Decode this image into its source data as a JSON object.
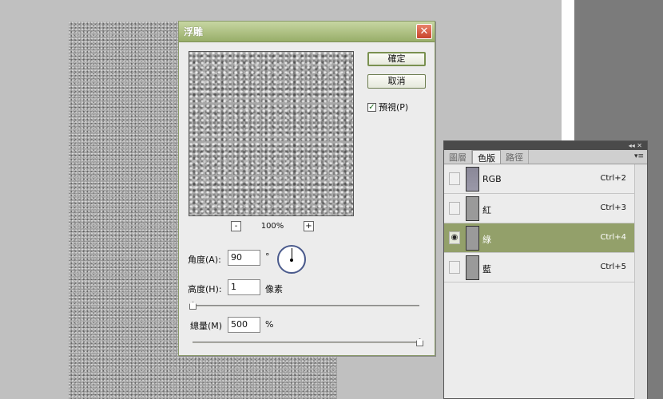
{
  "dialog": {
    "title": "浮雕",
    "close_symbol": "✕",
    "ok_label": "確定",
    "cancel_label": "取消",
    "preview_label": "預視(P)",
    "preview_checked": true,
    "zoom_out": "-",
    "zoom_in": "+",
    "zoom_value": "100%",
    "angle_label": "角度(A):",
    "angle_value": "90",
    "angle_unit": "°",
    "height_label": "高度(H):",
    "height_value": "1",
    "height_unit": "像素",
    "amount_label": "總量(M)",
    "amount_value": "500",
    "amount_unit": "%"
  },
  "panel": {
    "top_icons": "◂◂  ✕",
    "menu_icon": "▾≡",
    "tabs": [
      "圖層",
      "色版",
      "路徑"
    ],
    "active_tab": 1,
    "channels": [
      {
        "name": "RGB",
        "shortcut": "Ctrl+2",
        "visible": false,
        "selected": false
      },
      {
        "name": "紅",
        "shortcut": "Ctrl+3",
        "visible": false,
        "selected": false
      },
      {
        "name": "綠",
        "shortcut": "Ctrl+4",
        "visible": true,
        "selected": true
      },
      {
        "name": "藍",
        "shortcut": "Ctrl+5",
        "visible": false,
        "selected": false
      }
    ]
  },
  "colors": {
    "title_bar": "#98ae69",
    "selected_row": "#93a06a",
    "close_button": "#c8442c"
  },
  "icons": {
    "eye": "eye-icon",
    "check": "checkmark-icon"
  }
}
